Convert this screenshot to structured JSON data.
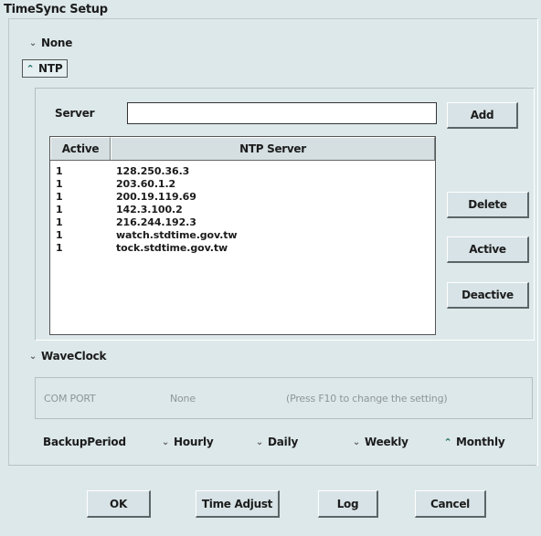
{
  "window": {
    "title": "TimeSync Setup"
  },
  "mode": {
    "none_label": "None",
    "ntp_label": "NTP",
    "waveclock_label": "WaveClock",
    "selected": "NTP"
  },
  "ntp": {
    "server_label": "Server",
    "server_value": "",
    "add_label": "Add",
    "delete_label": "Delete",
    "active_label": "Active",
    "deactive_label": "Deactive",
    "columns": [
      "Active",
      "NTP Server"
    ],
    "servers": [
      {
        "active": "1",
        "host": "128.250.36.3"
      },
      {
        "active": "1",
        "host": "203.60.1.2"
      },
      {
        "active": "1",
        "host": "200.19.119.69"
      },
      {
        "active": "1",
        "host": "142.3.100.2"
      },
      {
        "active": "1",
        "host": "216.244.192.3"
      },
      {
        "active": "1",
        "host": "watch.stdtime.gov.tw"
      },
      {
        "active": "1",
        "host": "tock.stdtime.gov.tw"
      }
    ]
  },
  "waveclock": {
    "com_port_label": "COM PORT",
    "com_port_value": "None",
    "hint": "(Press F10 to change the setting)"
  },
  "backup": {
    "label": "BackupPeriod",
    "options": [
      "Hourly",
      "Daily",
      "Weekly",
      "Monthly"
    ],
    "selected": "Monthly"
  },
  "footer": {
    "ok_label": "OK",
    "time_adjust_label": "Time Adjust",
    "log_label": "Log",
    "cancel_label": "Cancel"
  },
  "colors": {
    "background": "#dde8ea",
    "selected_indicator": "#1a6e62"
  }
}
